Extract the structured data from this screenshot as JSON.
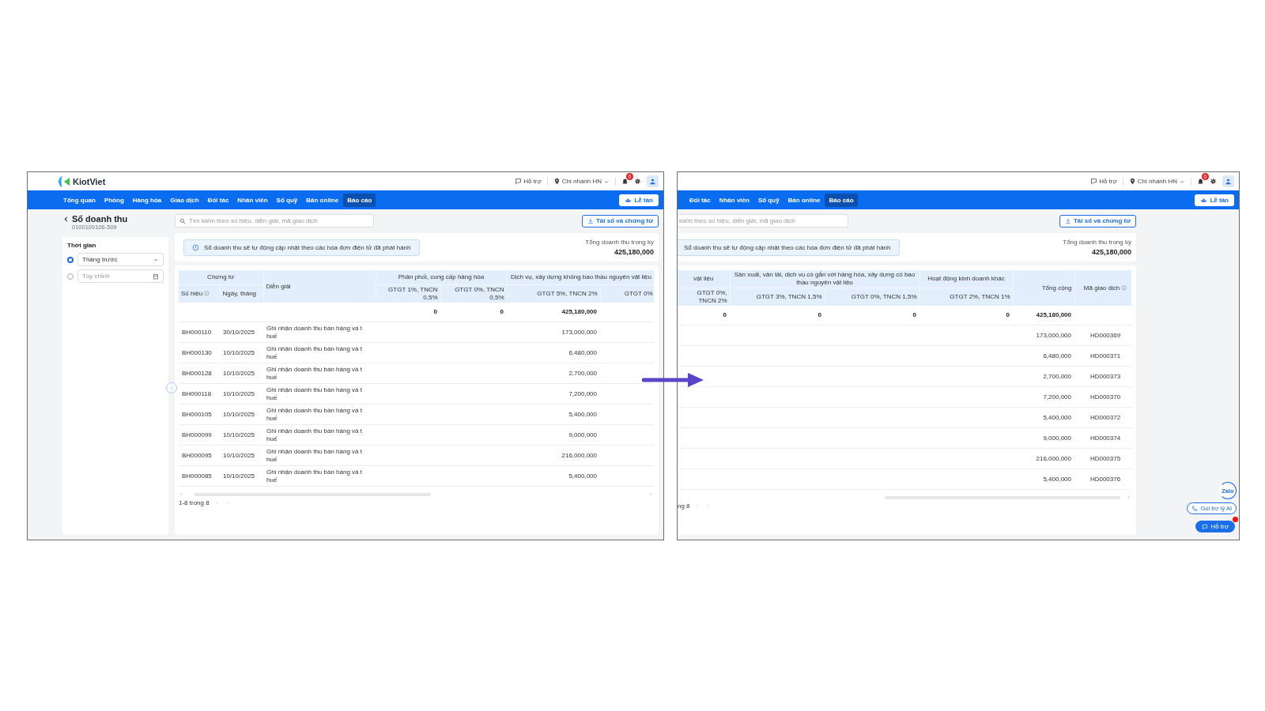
{
  "screens": [
    {
      "logo": {
        "text": "KiotViet"
      },
      "topbar": {
        "help": "Hỗ trợ",
        "branch": "Chi nhánh HN",
        "notifications": "0"
      },
      "nav": [
        {
          "label": "Tổng quan",
          "selected": false
        },
        {
          "label": "Phòng",
          "selected": false
        },
        {
          "label": "Hàng hóa",
          "selected": false
        },
        {
          "label": "Giao dịch",
          "selected": false
        },
        {
          "label": "Đối tác",
          "selected": false
        },
        {
          "label": "Nhân viên",
          "selected": false
        },
        {
          "label": "Sổ quỹ",
          "selected": false
        },
        {
          "label": "Bán online",
          "selected": false
        },
        {
          "label": "Báo cáo",
          "selected": true
        }
      ],
      "reception": "Lễ tân",
      "page_title": "Sổ doanh thu",
      "page_subtitle": "0100109106-509",
      "sidebar": {
        "title": "Thời gian",
        "options": [
          {
            "kind": "select",
            "value": "Tháng trước",
            "selected": true
          },
          {
            "kind": "date",
            "placeholder": "Tùy chỉnh",
            "selected": false
          }
        ]
      },
      "search": {
        "placeholder": "Tìm kiếm theo số hiệu, diễn giải, mã giao dịch",
        "icon": true
      },
      "download": "Tải sổ và chứng từ",
      "banner": {
        "text": "Sổ doanh thu sẽ tự động cập nhật theo các hóa đơn điện tử đã phát hành",
        "icon": true
      },
      "total": {
        "label": "Tổng doanh thu trong kỳ",
        "value": "425,180,000"
      },
      "table": {
        "groups": [
          {
            "kind": "group",
            "label": "Chứng từ",
            "columns": [
              {
                "label": "Số hiệu",
                "kind": "text",
                "info": true,
                "values": [
                  "BH000110",
                  "BH000130",
                  "BH000128",
                  "BH000118",
                  "BH000105",
                  "BH000099",
                  "BH000095",
                  "BH000085"
                ]
              },
              {
                "label": "Ngày, tháng",
                "kind": "text",
                "values": [
                  "30/10/2025",
                  "10/10/2025",
                  "10/10/2025",
                  "10/10/2025",
                  "10/10/2025",
                  "10/10/2025",
                  "10/10/2025",
                  "10/10/2025"
                ]
              }
            ]
          },
          {
            "kind": "text_column",
            "label": "Diễn giải",
            "values": [
              "Ghi nhận doanh thu bán hàng và t\nhuế",
              "Ghi nhận doanh thu bán hàng và t\nhuế",
              "Ghi nhận doanh thu bán hàng và t\nhuế",
              "Ghi nhận doanh thu bán hàng và t\nhuế",
              "Ghi nhận doanh thu bán hàng và t\nhuế",
              "Ghi nhận doanh thu bán hàng và t\nhuế",
              "Ghi nhận doanh thu bán hàng và t\nhuế",
              "Ghi nhận doanh thu bán hàng và t\nhuế"
            ]
          },
          {
            "kind": "group",
            "label": "Phân phối, cung cấp hàng hóa",
            "columns": [
              {
                "label": "GTGT 1%, TNCN 0,5%",
                "kind": "number",
                "total": "0"
              },
              {
                "label": "GTGT 0%, TNCN 0,5%",
                "kind": "number",
                "total": "0"
              }
            ]
          },
          {
            "kind": "group",
            "label": "Dịch vụ, xây dựng không bao thầu nguyên vật liệu",
            "columns": [
              {
                "label": "GTGT 5%, TNCN 2%",
                "kind": "number",
                "total": "425,180,000",
                "values": [
                  "173,000,000",
                  "6,480,000",
                  "2,700,000",
                  "7,200,000",
                  "5,400,000",
                  "9,000,000",
                  "216,000,000",
                  "5,400,000"
                ]
              },
              {
                "label": "GTGT 0%",
                "kind": "number"
              }
            ]
          }
        ]
      },
      "pagination": "1-8 trong 8"
    },
    {
      "topbar": {
        "help": "Hỗ trợ",
        "branch": "Chi nhánh HN",
        "notifications": "0"
      },
      "nav": [
        {
          "label": "Đối tác",
          "selected": false
        },
        {
          "label": "Nhân viên",
          "selected": false
        },
        {
          "label": "Sổ quỹ",
          "selected": false
        },
        {
          "label": "Bán online",
          "selected": false
        },
        {
          "label": "Báo cáo",
          "selected": true
        }
      ],
      "reception": "Lễ tân",
      "search": {
        "placeholder": "kiếm theo số hiệu, diễn giải, mã giao dịch",
        "icon": false
      },
      "download": "Tải sổ và chứng từ",
      "banner": {
        "text": "Sổ doanh thu sẽ tự động cập nhật theo các hóa đơn điện tử đã phát hành",
        "icon": false
      },
      "total": {
        "label": "Tổng doanh thu trong kỳ",
        "value": "425,180,000"
      },
      "table": {
        "groups": [
          {
            "kind": "group",
            "label": "vật liệu",
            "columns": [
              {
                "label": "GTGT 0%, TNCN 2%",
                "kind": "number",
                "total": "0"
              }
            ]
          },
          {
            "kind": "group",
            "label": "Sản xuất, vận tải, dịch vụ có gắn với hàng hóa, xây dựng có bao thầu nguyên vật liệu",
            "columns": [
              {
                "label": "GTGT 3%, TNCN 1,5%",
                "kind": "number",
                "total": "0"
              },
              {
                "label": "GTGT 0%, TNCN 1,5%",
                "kind": "number",
                "total": "0"
              }
            ]
          },
          {
            "kind": "group",
            "label": "Hoạt động kinh doanh khác",
            "columns": [
              {
                "label": "GTGT 2%, TNCN 1%",
                "kind": "number",
                "total": "0"
              }
            ]
          },
          {
            "kind": "number_column",
            "label": "Tổng cộng",
            "total": "425,180,000",
            "values": [
              "173,000,000",
              "6,480,000",
              "2,700,000",
              "7,200,000",
              "5,400,000",
              "9,000,000",
              "216,000,000",
              "5,400,000"
            ]
          },
          {
            "kind": "center_column",
            "label": "Mã giao dịch",
            "info": true,
            "values": [
              "HD000369",
              "HD000371",
              "HD000373",
              "HD000370",
              "HD000372",
              "HD000374",
              "HD000375",
              "HD000376"
            ]
          }
        ]
      },
      "pagination": "ng 8",
      "floating": {
        "zalo": "Zalo",
        "ai": "Gọi trợ lý AI",
        "support": "Hỗ trợ",
        "unread": true
      }
    }
  ]
}
